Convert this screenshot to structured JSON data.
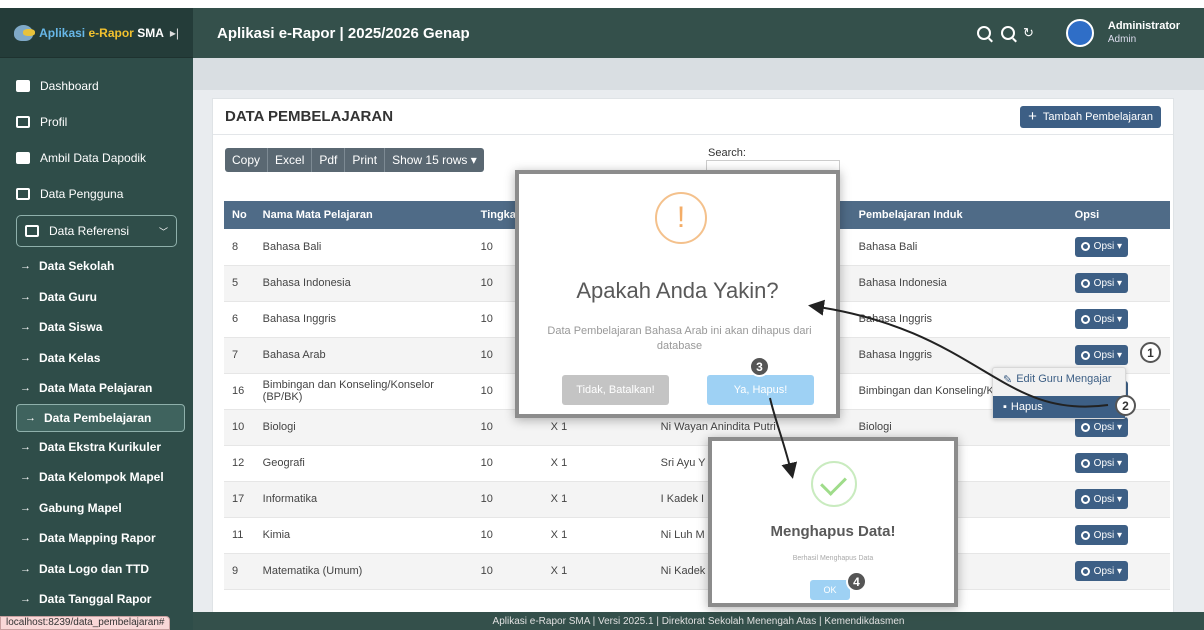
{
  "sidebar": {
    "brand_part1": "Aplikasi",
    "brand_part2": "e-Rapor",
    "brand_part3": "SMA",
    "collapse_icon": "▸|",
    "items": [
      {
        "label": "Dashboard",
        "icon": "dashboard-icon"
      },
      {
        "label": "Profil",
        "icon": "profile-icon"
      },
      {
        "label": "Ambil Data Dapodik",
        "icon": "database-icon"
      },
      {
        "label": "Data Pengguna",
        "icon": "users-icon"
      }
    ],
    "group": {
      "label": "Data Referensi",
      "icon": "monitor-icon"
    },
    "sub_items": [
      "Data Sekolah",
      "Data Guru",
      "Data Siswa",
      "Data Kelas",
      "Data Mata Pelajaran",
      "Data Pembelajaran",
      "Data Ekstra Kurikuler",
      "Data Kelompok Mapel",
      "Gabung Mapel",
      "Data Mapping Rapor",
      "Data Logo dan TTD",
      "Data Tanggal Rapor"
    ],
    "active_sub": "Data Pembelajaran"
  },
  "status_url": "localhost:8239/data_pembelajaran#",
  "header": {
    "title": "Aplikasi e-Rapor | 2025/2026 Genap",
    "user_name": "Administrator",
    "user_role": "Admin"
  },
  "card": {
    "title": "DATA PEMBELAJARAN",
    "add_button": "Tambah Pembelajaran"
  },
  "toolbar": {
    "copy": "Copy",
    "excel": "Excel",
    "pdf": "Pdf",
    "print": "Print",
    "show_rows": "Show 15 rows ▾"
  },
  "search_label": "Search:",
  "table": {
    "columns": [
      "No",
      "Nama Mata Pelajaran",
      "Tingka",
      "",
      "",
      "Pembelajaran Induk",
      "Opsi"
    ],
    "rows": [
      {
        "no": "8",
        "nama": "Bahasa Bali",
        "tingkat": "10",
        "kelas": "",
        "guru": "",
        "induk": "Bahasa Bali"
      },
      {
        "no": "5",
        "nama": "Bahasa Indonesia",
        "tingkat": "10",
        "kelas": "",
        "guru": "",
        "induk": "Bahasa Indonesia"
      },
      {
        "no": "6",
        "nama": "Bahasa Inggris",
        "tingkat": "10",
        "kelas": "",
        "guru": "",
        "induk": "Bahasa Inggris"
      },
      {
        "no": "7",
        "nama": "Bahasa Arab",
        "tingkat": "10",
        "kelas": "",
        "guru": "",
        "induk": "Bahasa Inggris"
      },
      {
        "no": "16",
        "nama": "Bimbingan dan Konseling/Konselor (BP/BK)",
        "tingkat": "10",
        "kelas": "",
        "guru": "",
        "induk": "Bimbingan dan Konseling/K (BP/BK)"
      },
      {
        "no": "10",
        "nama": "Biologi",
        "tingkat": "10",
        "kelas": "X 1",
        "guru": "Ni Wayan Anindita Putri",
        "induk": "Biologi"
      },
      {
        "no": "12",
        "nama": "Geografi",
        "tingkat": "10",
        "kelas": "X 1",
        "guru": "Sri Ayu Y",
        "induk": ""
      },
      {
        "no": "17",
        "nama": "Informatika",
        "tingkat": "10",
        "kelas": "X 1",
        "guru": "I Kadek I",
        "induk": ""
      },
      {
        "no": "11",
        "nama": "Kimia",
        "tingkat": "10",
        "kelas": "X 1",
        "guru": "Ni Luh M Sari",
        "induk": ""
      },
      {
        "no": "9",
        "nama": "Matematika (Umum)",
        "tingkat": "10",
        "kelas": "X 1",
        "guru": "Ni Kadek",
        "induk": ""
      }
    ],
    "opsi_label": "Opsi ▾"
  },
  "dropdown": {
    "edit": "Edit Guru Mengajar",
    "hapus": "Hapus"
  },
  "confirm_modal": {
    "title": "Apakah Anda Yakin?",
    "text": "Data Pembelajaran Bahasa Arab ini akan dihapus dari database",
    "cancel": "Tidak, Batalkan!",
    "ok": "Ya, Hapus!"
  },
  "success_modal": {
    "title": "Menghapus Data!",
    "text": "Berhasil Menghapus Data",
    "ok": "OK"
  },
  "steps": [
    "1",
    "2",
    "3",
    "4"
  ],
  "footer": "Aplikasi e-Rapor SMA | Versi 2025.1 | Direktorat Sekolah Menengah Atas | Kemendikdasmen"
}
